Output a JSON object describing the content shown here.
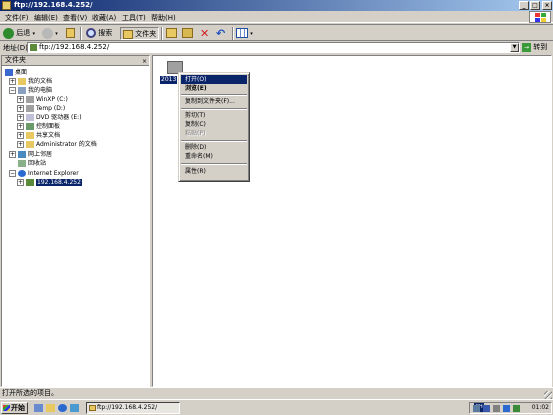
{
  "window": {
    "title": "ftp://192.168.4.252/",
    "min_glyph": "_",
    "max_glyph": "□",
    "close_glyph": "×"
  },
  "menubar": {
    "items": [
      "文件(F)",
      "编辑(E)",
      "查看(V)",
      "收藏(A)",
      "工具(T)",
      "帮助(H)"
    ]
  },
  "toolbar": {
    "back": "后退",
    "search": "搜索",
    "folders": "文件夹"
  },
  "address": {
    "label": "地址(D)",
    "value": "ftp://192.168.4.252/",
    "go": "转到",
    "go_glyph": "→"
  },
  "folders_pane": {
    "title": "文件夹",
    "close_glyph": "×",
    "items": [
      {
        "label": "桌面",
        "icon": "desktop-icon"
      },
      {
        "label": "我的文档",
        "icon": "documents-folder-icon"
      },
      {
        "label": "我的电脑",
        "icon": "computer-icon"
      },
      {
        "label": "WinXP (C:)",
        "icon": "drive-icon"
      },
      {
        "label": "Temp (D:)",
        "icon": "drive-icon"
      },
      {
        "label": "DVD 驱动器 (E:)",
        "icon": "dvd-drive-icon"
      },
      {
        "label": "控制面板",
        "icon": "control-panel-icon"
      },
      {
        "label": "共享文档",
        "icon": "shared-folder-icon"
      },
      {
        "label": "Administrator 的文档",
        "icon": "folder-icon"
      },
      {
        "label": "网上邻居",
        "icon": "network-icon"
      },
      {
        "label": "回收站",
        "icon": "recycle-bin-icon"
      },
      {
        "label": "Internet Explorer",
        "icon": "ie-icon"
      },
      {
        "label": "192.168.4.252",
        "icon": "ftp-site-icon"
      }
    ]
  },
  "content": {
    "folder_label": "2013"
  },
  "context_menu": {
    "items": [
      {
        "label": "打开(O)",
        "state": "highlighted"
      },
      {
        "label": "浏览(E)",
        "state": "bold"
      },
      {
        "label": "复制到文件夹(F)...",
        "state": "normal"
      },
      {
        "label": "剪切(T)",
        "state": "normal"
      },
      {
        "label": "复制(C)",
        "state": "normal"
      },
      {
        "label": "粘贴(P)",
        "state": "disabled"
      },
      {
        "label": "删除(D)",
        "state": "normal"
      },
      {
        "label": "重命名(M)",
        "state": "normal"
      },
      {
        "label": "属性(R)",
        "state": "normal"
      }
    ]
  },
  "statusbar": {
    "text": "打开所选的项目。"
  },
  "taskbar": {
    "start": "开始",
    "task": "ftp://192.168.4.252/",
    "lang": "CH",
    "clock": "01:02"
  },
  "colors": {
    "title_gradient_start": "#0a246a",
    "title_gradient_end": "#a6caf0",
    "selection": "#0a246a",
    "face": "#d4d0c8"
  }
}
